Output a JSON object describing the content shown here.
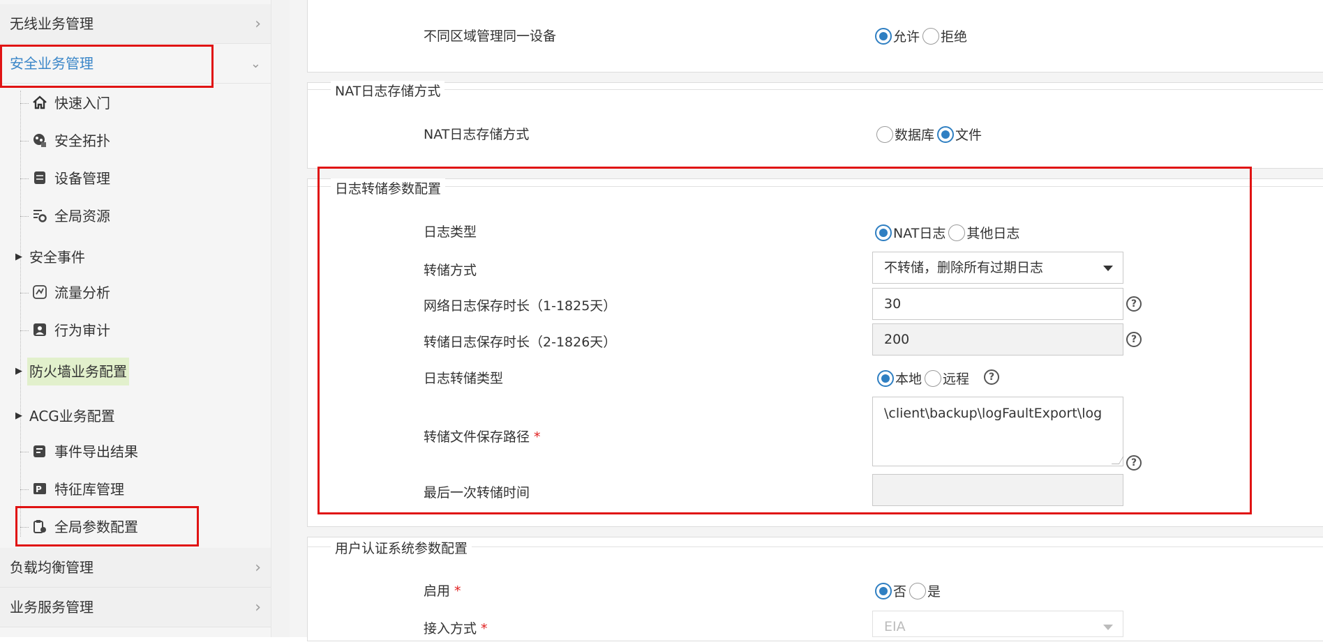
{
  "sidebar": {
    "menus": [
      {
        "label": "无线业务管理"
      },
      {
        "label": "安全业务管理"
      },
      {
        "label": "负载均衡管理"
      },
      {
        "label": "业务服务管理"
      }
    ],
    "items": [
      {
        "label": "快速入门",
        "icon": "home-icon"
      },
      {
        "label": "安全拓扑",
        "icon": "topology-icon"
      },
      {
        "label": "设备管理",
        "icon": "device-icon"
      },
      {
        "label": "全局资源",
        "icon": "resource-gear-icon"
      },
      {
        "label": "安全事件"
      },
      {
        "label": "流量分析",
        "icon": "traffic-icon"
      },
      {
        "label": "行为审计",
        "icon": "audit-icon"
      },
      {
        "label": "防火墙业务配置"
      },
      {
        "label": "ACG业务配置"
      },
      {
        "label": "事件导出结果",
        "icon": "export-icon"
      },
      {
        "label": "特征库管理",
        "icon": "signature-icon"
      },
      {
        "label": "全局参数配置",
        "icon": "global-param-icon"
      }
    ]
  },
  "main": {
    "top_row": {
      "label": "不同区域管理同一设备",
      "options": [
        "允许",
        "拒绝"
      ]
    },
    "nat_section": {
      "title": "NAT日志存储方式",
      "label": "NAT日志存储方式",
      "options": [
        "数据库",
        "文件"
      ]
    },
    "log_dump_section": {
      "title": "日志转储参数配置",
      "log_type_label": "日志类型",
      "log_type_options": [
        "NAT日志",
        "其他日志"
      ],
      "dump_mode_label": "转储方式",
      "dump_mode_value": "不转储，删除所有过期日志",
      "net_log_label": "网络日志保存时长（1-1825天）",
      "net_log_value": "30",
      "dump_log_label": "转储日志保存时长（2-1826天）",
      "dump_log_value": "200",
      "dump_type_label": "日志转储类型",
      "dump_type_options": [
        "本地",
        "远程"
      ],
      "path_label": "转储文件保存路径",
      "path_value": "\\client\\backup\\logFaultExport\\log",
      "last_time_label": "最后一次转储时间",
      "last_time_value": ""
    },
    "auth_section": {
      "title": "用户认证系统参数配置",
      "enable_label": "启用",
      "enable_options": [
        "否",
        "是"
      ],
      "access_label": "接入方式",
      "access_value": "EIA"
    },
    "required_mark": "*",
    "help_glyph": "?"
  },
  "colors": {
    "accent": "#2f7fc2",
    "highlight_box": "#e01313",
    "required": "#e02020",
    "active_menu_text": "#3a86c8",
    "highlight_item_bg": "#e2f0cc"
  }
}
